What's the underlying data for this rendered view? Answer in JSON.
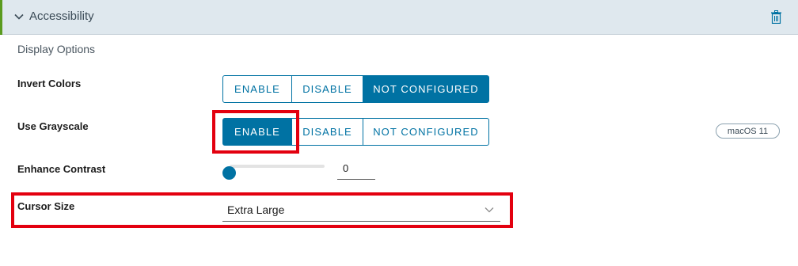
{
  "header": {
    "title": "Accessibility"
  },
  "section": {
    "label": "Display Options"
  },
  "rows": {
    "invert_colors": {
      "label": "Invert Colors",
      "options": [
        "ENABLE",
        "DISABLE",
        "NOT CONFIGURED"
      ],
      "selected": "NOT CONFIGURED"
    },
    "use_grayscale": {
      "label": "Use Grayscale",
      "options": [
        "ENABLE",
        "DISABLE",
        "NOT CONFIGURED"
      ],
      "selected": "ENABLE",
      "badge": "macOS 11"
    },
    "enhance_contrast": {
      "label": "Enhance Contrast",
      "value": "0"
    },
    "cursor_size": {
      "label": "Cursor Size",
      "value": "Extra Large"
    }
  },
  "colors": {
    "accent": "#0072a3",
    "header_bg": "#dfe8ee",
    "header_stripe": "#5a9b1f",
    "highlight": "#e3000f"
  },
  "icons": [
    "chevron-down-icon",
    "trash-icon",
    "caret-down-icon"
  ]
}
